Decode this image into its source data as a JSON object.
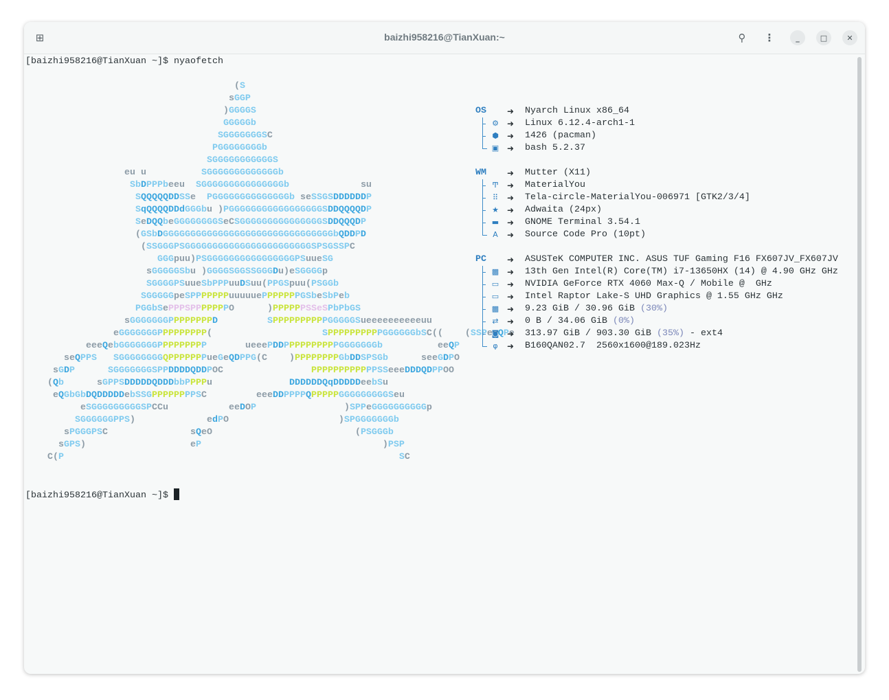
{
  "window": {
    "title": "baizhi958216@TianXuan:~"
  },
  "titlebar_icons": [
    "new-tab-icon",
    "search-icon",
    "menu-icon",
    "minimize-icon",
    "maximize-icon",
    "close-icon"
  ],
  "terminal": {
    "prompt": "[baizhi958216@TianXuan ~]$ ",
    "command": "nyaofetch",
    "final_prompt": "[baizhi958216@TianXuan ~]$ "
  },
  "art": [
    [
      "                                      (S"
    ],
    [
      "                                     sGGP"
    ],
    [
      "                                    )GGGGS"
    ],
    [
      "                                    GGGGGb"
    ],
    [
      "                                   SGGGGGGGSC"
    ],
    [
      "                                  PGGGGGGGGb"
    ],
    [
      "                                 SGGGGGGGGGGGS"
    ],
    [
      "                  eu u          SGGGGGGGGGGGGGb"
    ],
    [
      "                   SbDPPPbeeu  SGGGGGGGGGGGGGGGb             su"
    ],
    [
      "                    SQQQQQDDSSe  PGGGGGGGGGGGGGGb seSSGSDDDDDDP"
    ],
    [
      "                    SqQQQQDDdGGGbu )PGGGGGGGGGGGGGGGGGSDDQQQQDP"
    ],
    [
      "                    SeDQQbeGGGGGGGGSeCSGGGGGGGGGGGGGGGSDDQQQDP"
    ],
    [
      "                    (GSbDGGGGGGGGGGGGGGGGGGGGGGGGGGGGGGGbQDDPD"
    ],
    [
      "                     (SSGGGPSGGGGGGGGGGGGGGGGGGGGGGGSPSGSSPC"
    ],
    [
      "                        GGGpuu)PSGGGGGGGGGGGGGGGGPSuueSG"
    ],
    [
      "                      sGGGGGSbu )GGGGSGGSSGGGDu)eSGGGGp"
    ],
    [
      "                      SGGGGPSuueSbPPPuuDSuu(PPGSpuu(PSGGb"
    ],
    [
      "                     SGGGGGpeSPP",
      {
        "y": "PPPPP"
      },
      "uuuuueP",
      {
        "y": "PPPPP"
      },
      "PGSbeSbPeb"
    ],
    [
      "                    PGGbSe",
      {
        "k": "PPPSPP"
      },
      {
        "y": "PPPP"
      },
      "PO      )",
      {
        "y": "PPPPP"
      },
      {
        "k": "PSSeS"
      },
      "PbPbGS"
    ],
    [
      "                  sGGGGGGGP",
      {
        "y": "PPPPPPP"
      },
      "D         S",
      {
        "y": "PPPPPPPPP"
      },
      "PGGGGGSueeeeeeeeeeuu"
    ],
    [
      "                eGGGGGGGP",
      {
        "y": "PPPPPPPP"
      },
      "(                    S",
      {
        "y": "PPPPPPPPP"
      },
      "PGGGGGGbSC((    (SSPeeQPe"
    ],
    [
      "           eeeQebGGGGGGGP",
      {
        "y": "PPPPPPP"
      },
      "P       ueeePDDP",
      {
        "y": "PPPPPPPP"
      },
      "PGGGGGGGb          eeQP"
    ],
    [
      "       seQPPS   SGGGGGGGG",
      {
        "y": "QPPPPPP"
      },
      "PueGeQDPPG(C    )",
      {
        "y": "PPPPPPPP"
      },
      "GbDDSPSGb      seeGDPO"
    ],
    [
      "     sGDP      SGGGGGGGSPPDDDDQDDPOC                ",
      {
        "y": "PPPPPPPPPP"
      },
      "PPSSeeeDDDQDPPOO"
    ],
    [
      "    (Qb      sGPPSDDDDDQDDDbbP",
      {
        "y": "PPP"
      },
      "u              DDDDDDQqDDDDDeebSu"
    ],
    [
      "     eQGbGbDQDDDDDebSSG",
      {
        "y": "PPPPPP"
      },
      "PPSC         eeeDDPPPPQ",
      {
        "y": "PPPPP"
      },
      "GGGGGGGGGSeu"
    ],
    [
      "          eSGGGGGGGGGSPCCu           eeDOP                )SPPeGGGGGGGGGGp"
    ],
    [
      "         SGGGGGGPPS)             edPO                    )SPGGGGGGGb"
    ],
    [
      "       sPGGGPSC               sQeO                          (PSGGGb"
    ],
    [
      "      sGPS)                   eP                                 )PSP"
    ],
    [
      "    C(P                                                             SC"
    ]
  ],
  "info": {
    "arrow": "➜",
    "groups": [
      {
        "label": "OS",
        "value": "Nyarch Linux x86_64",
        "items": [
          {
            "icon": "gear-icon",
            "glyph": "⚙",
            "value": "Linux 6.12.4-arch1-1"
          },
          {
            "icon": "package-icon",
            "glyph": "⬢",
            "value": "1426 (pacman)"
          },
          {
            "icon": "shell-icon",
            "glyph": "▣",
            "value": "bash 5.2.37"
          }
        ]
      },
      {
        "label": "WM",
        "value": "Mutter (X11)",
        "items": [
          {
            "icon": "paint-roller-icon",
            "glyph": "Ͳ",
            "value": "MaterialYou"
          },
          {
            "icon": "grid-icon",
            "glyph": "⠿",
            "value": "Tela-circle-MaterialYou-006971 [GTK2/3/4]"
          },
          {
            "icon": "star-icon",
            "glyph": "★",
            "value": "Adwaita (24px)"
          },
          {
            "icon": "terminal-icon",
            "glyph": "▬",
            "value": "GNOME Terminal 3.54.1"
          },
          {
            "icon": "font-icon",
            "glyph": "A",
            "value": "Source Code Pro (10pt)"
          }
        ]
      },
      {
        "label": "PC",
        "value": "ASUSTeK COMPUTER INC. ASUS TUF Gaming F16 FX607JV_FX607JV",
        "items": [
          {
            "icon": "cpu-icon",
            "glyph": "▩",
            "value": "13th Gen Intel(R) Core(TM) i7-13650HX (14) @ 4.90 GHz GHz"
          },
          {
            "icon": "gpu-icon",
            "glyph": "▭",
            "value": "NVIDIA GeForce RTX 4060 Max-Q / Mobile @  GHz"
          },
          {
            "icon": "gpu-icon",
            "glyph": "▭",
            "value": "Intel Raptor Lake-S UHD Graphics @ 1.55 GHz GHz"
          },
          {
            "icon": "memory-icon",
            "glyph": "▩",
            "value": "9.23 GiB / 30.96 GiB ",
            "pct": "(30%)"
          },
          {
            "icon": "swap-icon",
            "glyph": "⇄",
            "value": "0 B / 34.06 GiB ",
            "pct": "(0%)"
          },
          {
            "icon": "disk-icon",
            "glyph": "◙",
            "value": "313.97 GiB / 903.30 GiB ",
            "pct": "(35%)",
            "suffix": " - ext4"
          },
          {
            "icon": "display-icon",
            "glyph": "φ",
            "value": "B160QAN02.7  2560x1600@189.023Hz"
          }
        ]
      }
    ]
  }
}
